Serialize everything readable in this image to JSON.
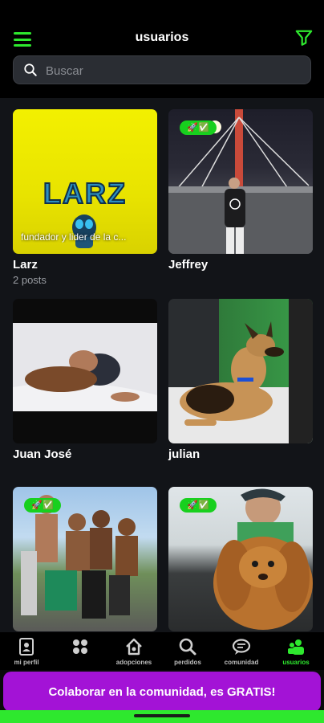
{
  "header": {
    "title": "usuarios",
    "menu_icon": "hamburger-menu-icon",
    "filter_icon": "filter-icon"
  },
  "search": {
    "placeholder": "Buscar",
    "value": ""
  },
  "users": [
    {
      "name": "Larz",
      "posts": "2 posts",
      "logo_text": "LARZ",
      "description": "fundador y lider de la c...",
      "photo": "yellow-logo"
    },
    {
      "name": "Jeffrey",
      "badge": "🚀✅",
      "photo": "bridge-night"
    },
    {
      "name": "Juan José",
      "photo": "boy-with-dog"
    },
    {
      "name": "julian",
      "photo": "german-shepherd"
    },
    {
      "name": "",
      "badge": "🚀✅",
      "photo": "group-friends"
    },
    {
      "name": "",
      "badge": "🚀✅",
      "photo": "man-with-cocker"
    }
  ],
  "nav": [
    {
      "label": "mi perfil",
      "icon": "profile-card-icon"
    },
    {
      "label": "",
      "icon": "apps-grid-icon"
    },
    {
      "label": "adopciones",
      "icon": "home-icon"
    },
    {
      "label": "perdidos",
      "icon": "search-icon"
    },
    {
      "label": "comunidad",
      "icon": "chat-bubble-icon"
    },
    {
      "label": "usuarios",
      "icon": "users-icon",
      "active": true
    }
  ],
  "cta": {
    "label": "Colaborar en la comunidad, es GRATIS!"
  },
  "colors": {
    "accent": "#2ee82e",
    "cta": "#a313d6",
    "badge": "#18d01e"
  }
}
